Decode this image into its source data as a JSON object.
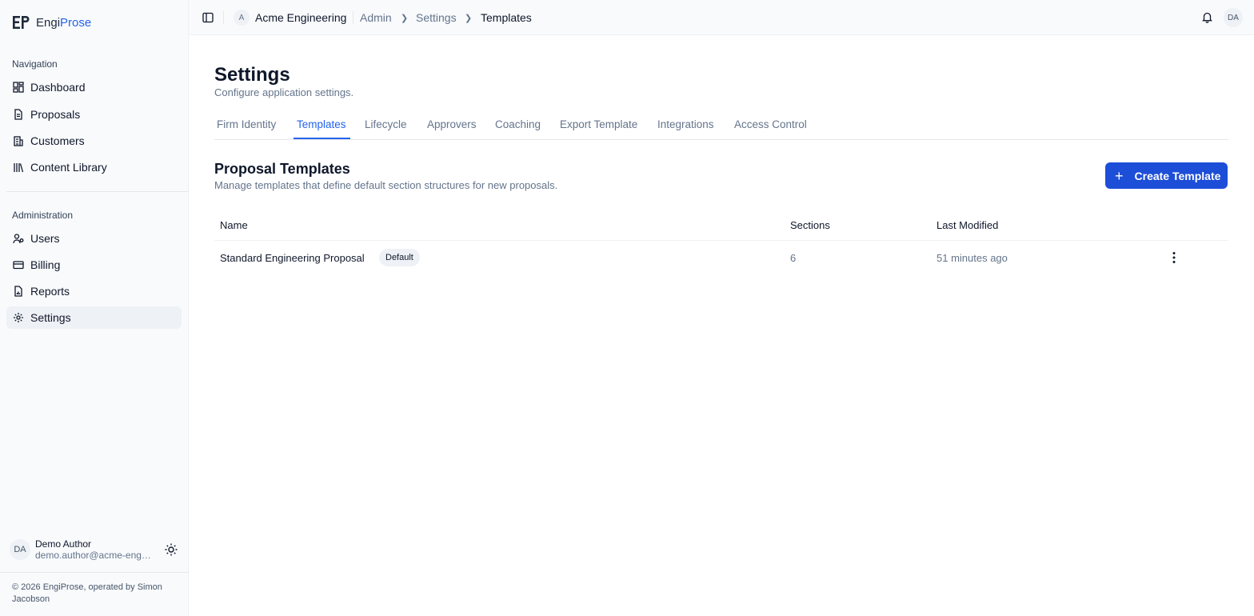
{
  "brand": {
    "name_part1": "Engi",
    "name_part2": "Prose"
  },
  "sidebar": {
    "nav_label": "Navigation",
    "nav_items": [
      {
        "label": "Dashboard",
        "icon": "dashboard-icon"
      },
      {
        "label": "Proposals",
        "icon": "document-icon"
      },
      {
        "label": "Customers",
        "icon": "building-icon"
      },
      {
        "label": "Content Library",
        "icon": "library-icon"
      }
    ],
    "admin_label": "Administration",
    "admin_items": [
      {
        "label": "Users",
        "icon": "users-icon"
      },
      {
        "label": "Billing",
        "icon": "credit-card-icon"
      },
      {
        "label": "Reports",
        "icon": "report-icon"
      },
      {
        "label": "Settings",
        "icon": "gear-icon",
        "active": true
      }
    ],
    "user": {
      "initials": "DA",
      "name": "Demo Author",
      "email": "demo.author@acme-engineering.com"
    },
    "copyright": "© 2026 EngiProse, operated by Simon Jacobson"
  },
  "topbar": {
    "org_initial": "A",
    "org_name": "Acme Engineering",
    "breadcrumb": [
      "Admin",
      "Settings",
      "Templates"
    ],
    "user_initials": "DA"
  },
  "page": {
    "title": "Settings",
    "subtitle": "Configure application settings.",
    "tabs": [
      "Firm Identity",
      "Templates",
      "Lifecycle",
      "Approvers",
      "Coaching",
      "Export Template",
      "Integrations",
      "Access Control"
    ],
    "active_tab": "Templates"
  },
  "templates": {
    "title": "Proposal Templates",
    "subtitle": "Manage templates that define default section structures for new proposals.",
    "create_label": "Create Template",
    "columns": [
      "Name",
      "Sections",
      "Last Modified"
    ],
    "rows": [
      {
        "name": "Standard Engineering Proposal",
        "badge": "Default",
        "sections": "6",
        "modified": "51 minutes ago"
      }
    ]
  },
  "colors": {
    "accent": "#2563eb",
    "button": "#1d4ed8",
    "sidebar_bg": "#f8fafc"
  }
}
